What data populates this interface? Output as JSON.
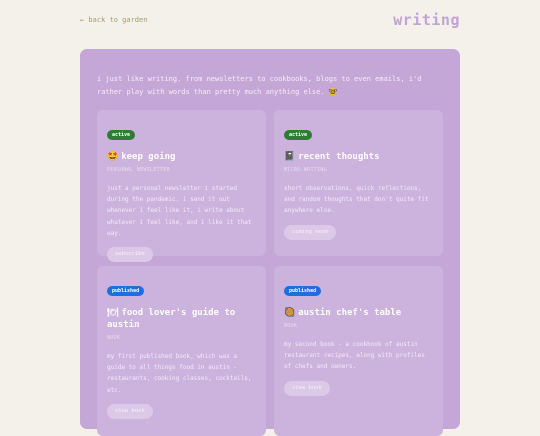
{
  "nav": {
    "back_label": "← back to garden"
  },
  "page": {
    "title": "writing"
  },
  "intro": "i just like writing. from newsletters to cookbooks, blogs to even emails, i'd rather play with words than pretty much anything else. 🤓",
  "cards": [
    {
      "badge": "active",
      "badge_color": "#2e7d32",
      "emoji": "🤩",
      "title": "keep going",
      "subtitle": "PERSONAL NEWSLETTER",
      "description": "just a personal newsletter i started during the pandemic. i send it out whenever i feel like it, i write about whatever i feel like, and i like it that way.",
      "button": "subscribe"
    },
    {
      "badge": "active",
      "badge_color": "#2e7d32",
      "emoji": "📓",
      "title": "recent thoughts",
      "subtitle": "MICRO-WRITING",
      "description": "short observations, quick reflections, and random thoughts that don't quite fit anywhere else.",
      "button": "coming soon"
    },
    {
      "badge": "published",
      "badge_color": "#1e6fd9",
      "emoji": "🍽",
      "title": "food lover's guide to austin",
      "subtitle": "BOOK",
      "description": "my first published book, which was a guide to all things food in austin - restaurants, cooking classes, cocktails, etc.",
      "button": "view book"
    },
    {
      "badge": "published",
      "badge_color": "#1e6fd9",
      "emoji": "🥘",
      "title": "austin chef's table",
      "subtitle": "BOOK",
      "description": "my second book - a cookbook of austin restaurant recipes, along with profiles of chefs and owners.",
      "button": "view book"
    }
  ]
}
